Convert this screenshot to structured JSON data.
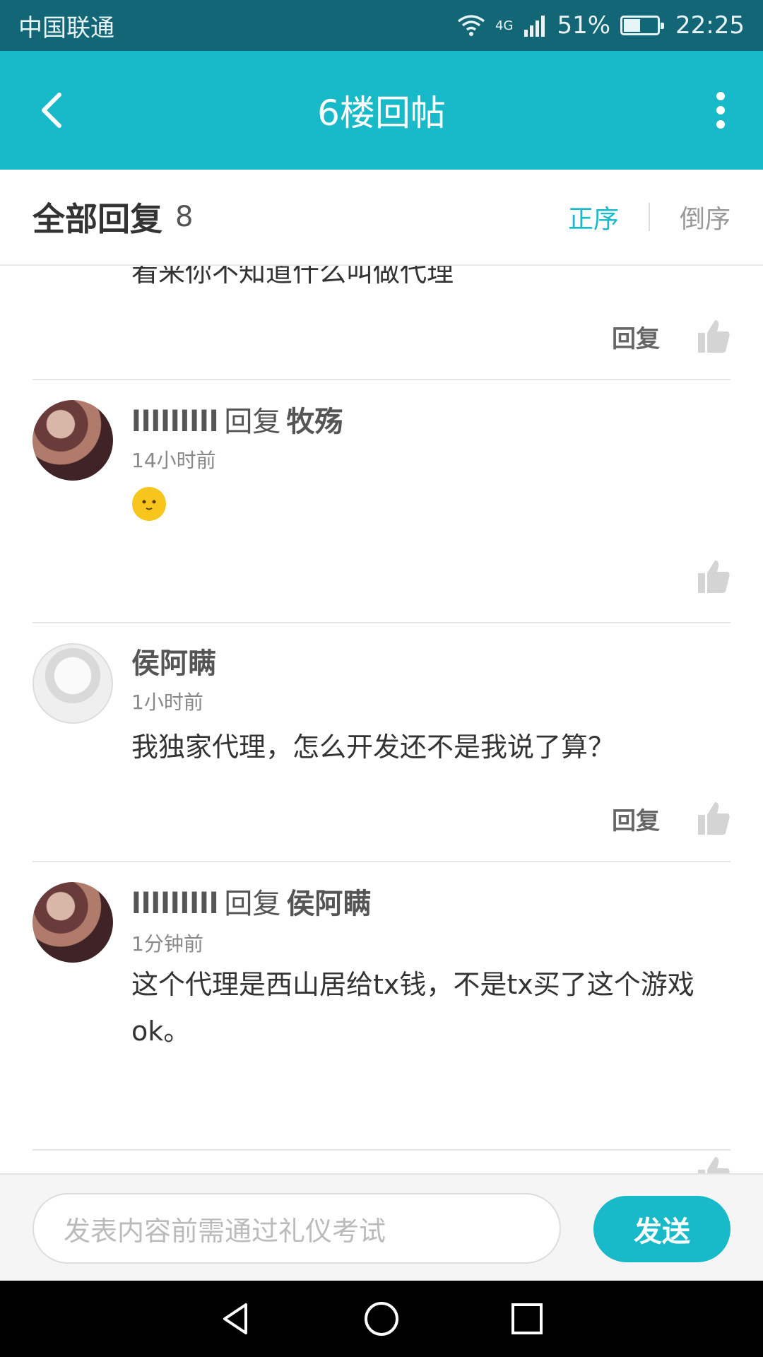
{
  "status_bar": {
    "carrier": "中国联通",
    "network": "4G",
    "battery": "51%",
    "time": "22:25",
    "battery_level": 0.51
  },
  "app_bar": {
    "title": "6楼回帖"
  },
  "header": {
    "title": "全部回复",
    "count": "8",
    "sort_asc": "正序",
    "sort_desc": "倒序"
  },
  "partial_reply": {
    "text": "看来你不知道什么叫做代理",
    "reply_label": "回复"
  },
  "replies": [
    {
      "user": "lllllllll",
      "reply_word": "回复",
      "reply_to": "牧殇",
      "time": "14小时前",
      "emoji": "smile-emoji"
    },
    {
      "user": "侯阿瞒",
      "time": "1小时前",
      "text": "我独家代理，怎么开发还不是我说了算？",
      "reply_label": "回复"
    },
    {
      "user": "lllllllll",
      "reply_word": "回复",
      "reply_to": "侯阿瞒",
      "time": "1分钟前",
      "text": "这个代理是西山居给tx钱，不是tx买了这个游戏ok。"
    }
  ],
  "composer": {
    "placeholder": "发表内容前需通过礼仪考试",
    "send_label": "发送"
  },
  "colors": {
    "accent": "#18b9c9",
    "status_bar": "#136675"
  }
}
